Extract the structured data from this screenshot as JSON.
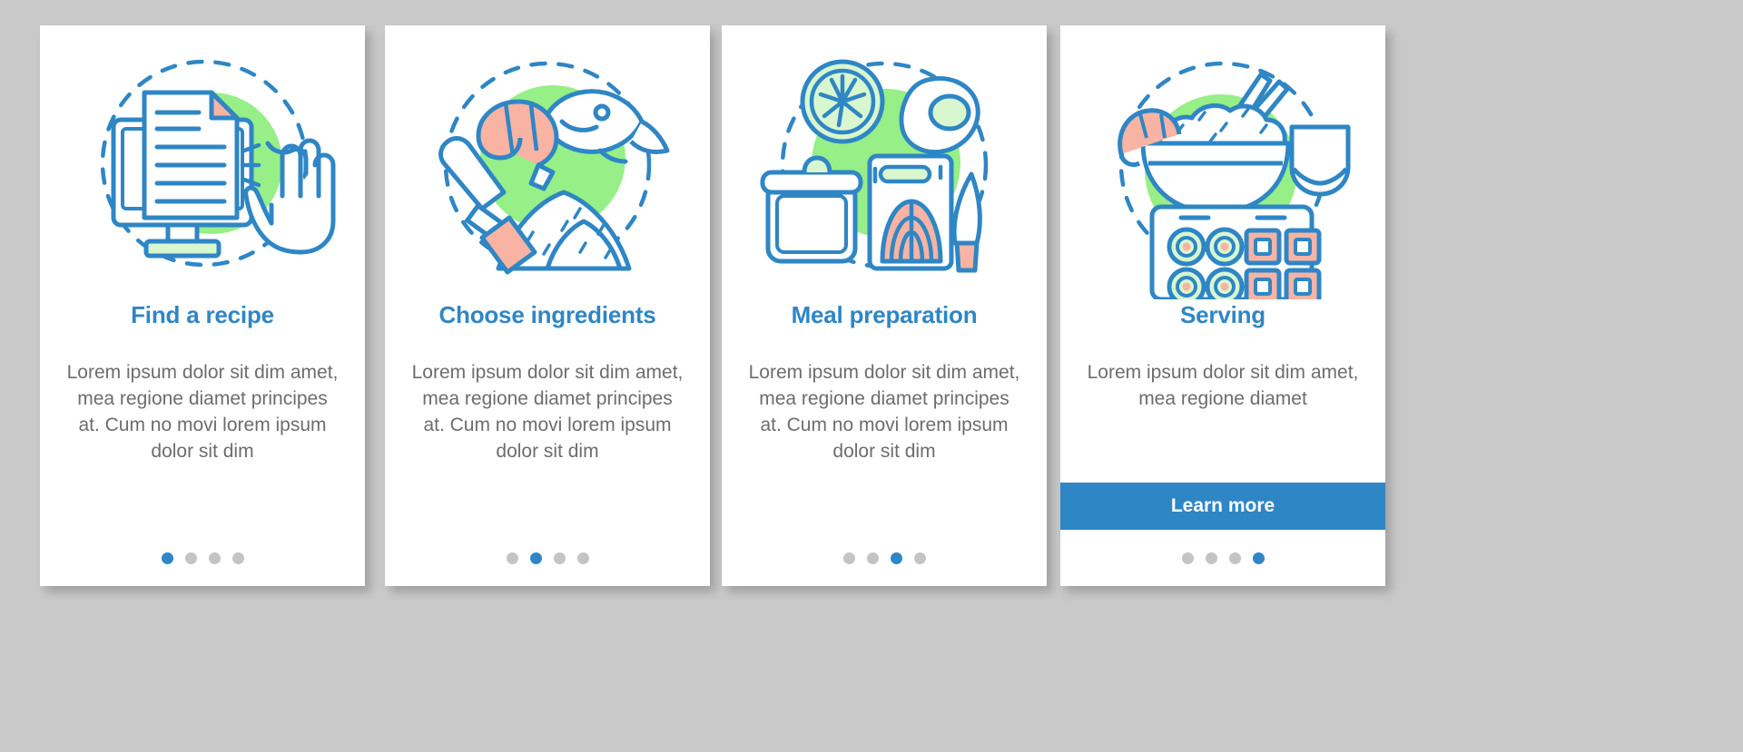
{
  "page": {
    "background_color": "#c9c9c9",
    "card_background": "#ffffff",
    "accent_color": "#2f86c5",
    "muted_text_color": "#6d6d6d",
    "dot_inactive_color": "#c4c4c4",
    "illustration_green": "#96ef87",
    "illustration_coral": "#f8b3a3",
    "illustration_stroke": "#2f86c5"
  },
  "cards": [
    {
      "title": "Find a recipe",
      "body": "Lorem ipsum dolor sit dim amet, mea regione diamet principes at. Cum no movi lorem ipsum dolor sit dim",
      "illustration": "monitor-document-hand-icon",
      "dots": {
        "count": 4,
        "active_index": 0
      },
      "button": null
    },
    {
      "title": "Choose ingredients",
      "body": "Lorem ipsum dolor sit dim amet, mea regione diamet principes at. Cum no movi lorem ipsum dolor sit dim",
      "illustration": "shrimp-fish-rice-icon",
      "dots": {
        "count": 4,
        "active_index": 1
      },
      "button": null
    },
    {
      "title": "Meal preparation",
      "body": "Lorem ipsum dolor sit dim amet, mea regione diamet principes at. Cum no movi lorem ipsum dolor sit dim",
      "illustration": "pot-salmon-knife-icon",
      "dots": {
        "count": 4,
        "active_index": 2
      },
      "button": null
    },
    {
      "title": "Serving",
      "body": "Lorem ipsum dolor sit dim amet, mea regione diamet",
      "illustration": "sushi-bowl-chopsticks-icon",
      "dots": {
        "count": 4,
        "active_index": 3
      },
      "button": {
        "label": "Learn more"
      }
    }
  ]
}
